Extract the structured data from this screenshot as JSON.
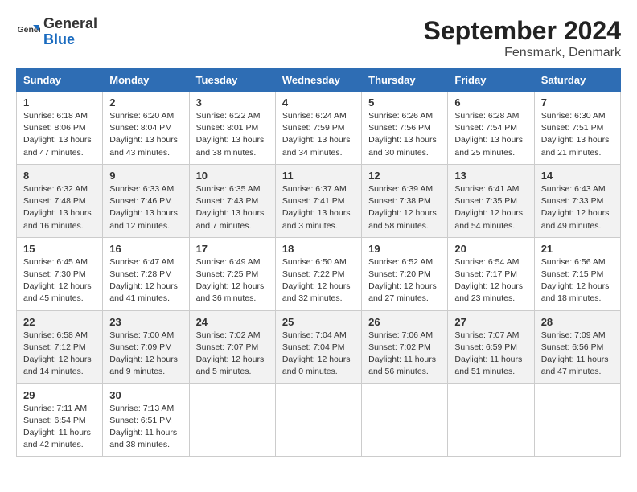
{
  "header": {
    "logo_line1": "General",
    "logo_line2": "Blue",
    "title": "September 2024",
    "subtitle": "Fensmark, Denmark"
  },
  "days_of_week": [
    "Sunday",
    "Monday",
    "Tuesday",
    "Wednesday",
    "Thursday",
    "Friday",
    "Saturday"
  ],
  "weeks": [
    [
      {
        "day": "1",
        "info": "Sunrise: 6:18 AM\nSunset: 8:06 PM\nDaylight: 13 hours\nand 47 minutes."
      },
      {
        "day": "2",
        "info": "Sunrise: 6:20 AM\nSunset: 8:04 PM\nDaylight: 13 hours\nand 43 minutes."
      },
      {
        "day": "3",
        "info": "Sunrise: 6:22 AM\nSunset: 8:01 PM\nDaylight: 13 hours\nand 38 minutes."
      },
      {
        "day": "4",
        "info": "Sunrise: 6:24 AM\nSunset: 7:59 PM\nDaylight: 13 hours\nand 34 minutes."
      },
      {
        "day": "5",
        "info": "Sunrise: 6:26 AM\nSunset: 7:56 PM\nDaylight: 13 hours\nand 30 minutes."
      },
      {
        "day": "6",
        "info": "Sunrise: 6:28 AM\nSunset: 7:54 PM\nDaylight: 13 hours\nand 25 minutes."
      },
      {
        "day": "7",
        "info": "Sunrise: 6:30 AM\nSunset: 7:51 PM\nDaylight: 13 hours\nand 21 minutes."
      }
    ],
    [
      {
        "day": "8",
        "info": "Sunrise: 6:32 AM\nSunset: 7:48 PM\nDaylight: 13 hours\nand 16 minutes."
      },
      {
        "day": "9",
        "info": "Sunrise: 6:33 AM\nSunset: 7:46 PM\nDaylight: 13 hours\nand 12 minutes."
      },
      {
        "day": "10",
        "info": "Sunrise: 6:35 AM\nSunset: 7:43 PM\nDaylight: 13 hours\nand 7 minutes."
      },
      {
        "day": "11",
        "info": "Sunrise: 6:37 AM\nSunset: 7:41 PM\nDaylight: 13 hours\nand 3 minutes."
      },
      {
        "day": "12",
        "info": "Sunrise: 6:39 AM\nSunset: 7:38 PM\nDaylight: 12 hours\nand 58 minutes."
      },
      {
        "day": "13",
        "info": "Sunrise: 6:41 AM\nSunset: 7:35 PM\nDaylight: 12 hours\nand 54 minutes."
      },
      {
        "day": "14",
        "info": "Sunrise: 6:43 AM\nSunset: 7:33 PM\nDaylight: 12 hours\nand 49 minutes."
      }
    ],
    [
      {
        "day": "15",
        "info": "Sunrise: 6:45 AM\nSunset: 7:30 PM\nDaylight: 12 hours\nand 45 minutes."
      },
      {
        "day": "16",
        "info": "Sunrise: 6:47 AM\nSunset: 7:28 PM\nDaylight: 12 hours\nand 41 minutes."
      },
      {
        "day": "17",
        "info": "Sunrise: 6:49 AM\nSunset: 7:25 PM\nDaylight: 12 hours\nand 36 minutes."
      },
      {
        "day": "18",
        "info": "Sunrise: 6:50 AM\nSunset: 7:22 PM\nDaylight: 12 hours\nand 32 minutes."
      },
      {
        "day": "19",
        "info": "Sunrise: 6:52 AM\nSunset: 7:20 PM\nDaylight: 12 hours\nand 27 minutes."
      },
      {
        "day": "20",
        "info": "Sunrise: 6:54 AM\nSunset: 7:17 PM\nDaylight: 12 hours\nand 23 minutes."
      },
      {
        "day": "21",
        "info": "Sunrise: 6:56 AM\nSunset: 7:15 PM\nDaylight: 12 hours\nand 18 minutes."
      }
    ],
    [
      {
        "day": "22",
        "info": "Sunrise: 6:58 AM\nSunset: 7:12 PM\nDaylight: 12 hours\nand 14 minutes."
      },
      {
        "day": "23",
        "info": "Sunrise: 7:00 AM\nSunset: 7:09 PM\nDaylight: 12 hours\nand 9 minutes."
      },
      {
        "day": "24",
        "info": "Sunrise: 7:02 AM\nSunset: 7:07 PM\nDaylight: 12 hours\nand 5 minutes."
      },
      {
        "day": "25",
        "info": "Sunrise: 7:04 AM\nSunset: 7:04 PM\nDaylight: 12 hours\nand 0 minutes."
      },
      {
        "day": "26",
        "info": "Sunrise: 7:06 AM\nSunset: 7:02 PM\nDaylight: 11 hours\nand 56 minutes."
      },
      {
        "day": "27",
        "info": "Sunrise: 7:07 AM\nSunset: 6:59 PM\nDaylight: 11 hours\nand 51 minutes."
      },
      {
        "day": "28",
        "info": "Sunrise: 7:09 AM\nSunset: 6:56 PM\nDaylight: 11 hours\nand 47 minutes."
      }
    ],
    [
      {
        "day": "29",
        "info": "Sunrise: 7:11 AM\nSunset: 6:54 PM\nDaylight: 11 hours\nand 42 minutes."
      },
      {
        "day": "30",
        "info": "Sunrise: 7:13 AM\nSunset: 6:51 PM\nDaylight: 11 hours\nand 38 minutes."
      },
      {
        "day": "",
        "info": ""
      },
      {
        "day": "",
        "info": ""
      },
      {
        "day": "",
        "info": ""
      },
      {
        "day": "",
        "info": ""
      },
      {
        "day": "",
        "info": ""
      }
    ]
  ]
}
